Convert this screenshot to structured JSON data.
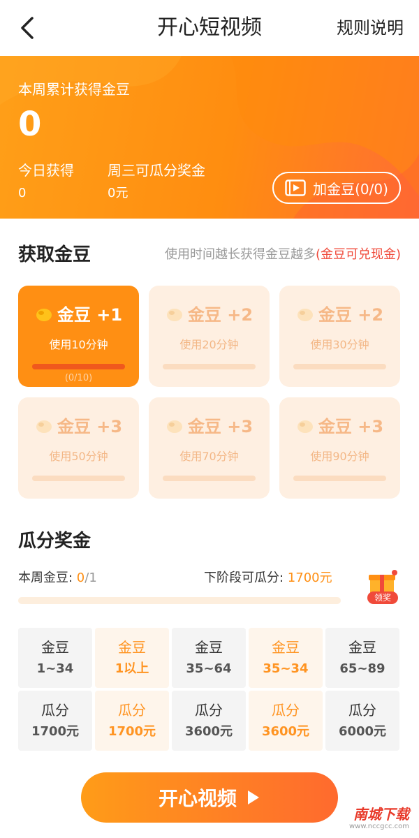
{
  "nav": {
    "title": "开心短视频",
    "rules": "规则说明"
  },
  "banner": {
    "weekly_label": "本周累计获得金豆",
    "weekly_value": "0",
    "today_label": "今日获得",
    "today_value": "0",
    "wednesday_label": "周三可瓜分奖金",
    "wednesday_value": "0元",
    "add_button": "加金豆(0/0)"
  },
  "earn": {
    "title": "获取金豆",
    "hint_prefix": "使用时间越长获得金豆越多",
    "hint_highlight": "(金豆可兑现金)",
    "cards": [
      {
        "reward": "金豆 +1",
        "duration": "使用10分钟",
        "progress": "(0/10)",
        "active": true
      },
      {
        "reward": "金豆 +2",
        "duration": "使用20分钟",
        "progress": "",
        "active": false
      },
      {
        "reward": "金豆 +2",
        "duration": "使用30分钟",
        "progress": "",
        "active": false
      },
      {
        "reward": "金豆 +3",
        "duration": "使用50分钟",
        "progress": "",
        "active": false
      },
      {
        "reward": "金豆 +3",
        "duration": "使用70分钟",
        "progress": "",
        "active": false
      },
      {
        "reward": "金豆 +3",
        "duration": "使用90分钟",
        "progress": "",
        "active": false
      }
    ]
  },
  "prize": {
    "title": "瓜分奖金",
    "week_beans_label": "本周金豆: ",
    "week_beans_current": "0",
    "week_beans_total": "/1",
    "next_label": "下阶段可瓜分: ",
    "next_value": "1700元",
    "claim": "领奖",
    "table": [
      [
        {
          "t": "金豆",
          "v": "1~34",
          "alt": false
        },
        {
          "t": "金豆",
          "v": "1以上",
          "alt": true
        },
        {
          "t": "金豆",
          "v": "35~64",
          "alt": false
        },
        {
          "t": "金豆",
          "v": "35~34",
          "alt": true
        },
        {
          "t": "金豆",
          "v": "65~89",
          "alt": false
        }
      ],
      [
        {
          "t": "瓜分",
          "v": "1700元",
          "alt": false
        },
        {
          "t": "瓜分",
          "v": "1700元",
          "alt": true
        },
        {
          "t": "瓜分",
          "v": "3600元",
          "alt": false
        },
        {
          "t": "瓜分",
          "v": "3600元",
          "alt": true
        },
        {
          "t": "瓜分",
          "v": "6000元",
          "alt": false
        }
      ]
    ]
  },
  "bottom": {
    "play_button": "开心视频"
  },
  "watermark": {
    "cn": "南城下载",
    "en": "www.nccgcc.com"
  },
  "colors": {
    "accent": "#ff8f13",
    "highlight": "#f04a3a"
  }
}
